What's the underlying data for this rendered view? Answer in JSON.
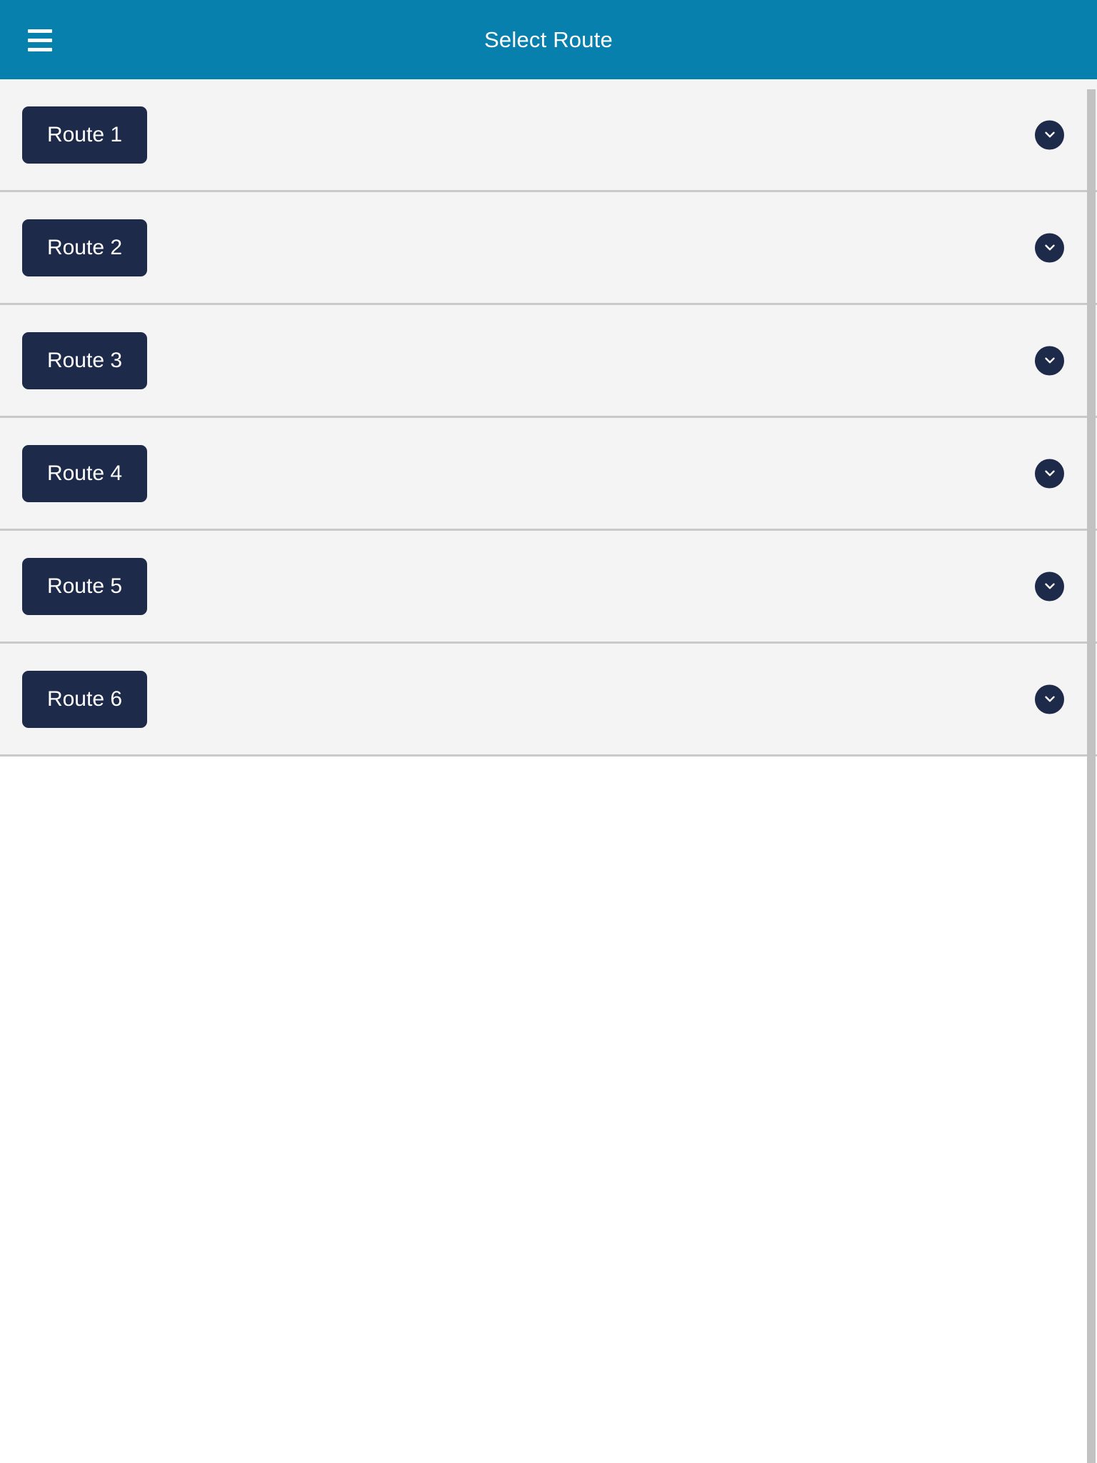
{
  "appbar": {
    "title": "Select Route",
    "menu_icon": "hamburger-menu-icon",
    "background_color": "#0880ad",
    "text_color": "#ffffff"
  },
  "theme": {
    "accent_color": "#0880ad",
    "button_color": "#1e2a4a",
    "row_background": "#f4f4f4",
    "divider_color": "#c9c9c9",
    "page_background": "#ffffff"
  },
  "list": {
    "expand_icon": "chevron-down-icon",
    "rows": [
      {
        "label": "Route 1",
        "expanded": false
      },
      {
        "label": "Route 2",
        "expanded": false
      },
      {
        "label": "Route 3",
        "expanded": false
      },
      {
        "label": "Route 4",
        "expanded": false
      },
      {
        "label": "Route 5",
        "expanded": false
      },
      {
        "label": "Route 6",
        "expanded": false
      }
    ]
  },
  "scrollbar": {
    "orientation": "vertical",
    "thumb_color": "#c2c2c2"
  }
}
